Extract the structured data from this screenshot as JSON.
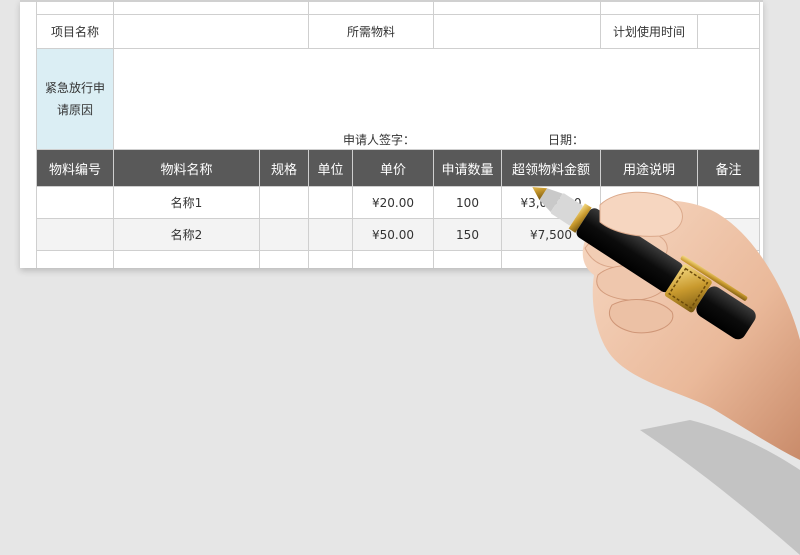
{
  "form": {
    "project_name_label": "项目名称",
    "materials_label": "所需物料",
    "planned_time_label": "计划使用时间",
    "reason_label": "紧急放行申请原因",
    "applicant_sign_label": "申请人签字：",
    "date_label": "日期："
  },
  "table": {
    "headers": [
      "物料编号",
      "物料名称",
      "规格",
      "单位",
      "单价",
      "申请数量",
      "超领物料金额",
      "用途说明",
      "备注"
    ],
    "rows": [
      {
        "code": "",
        "name": "名称1",
        "spec": "",
        "unit": "",
        "price": "¥20.00",
        "qty": "100",
        "amount": "¥3,000.00",
        "usage": "",
        "note": ""
      },
      {
        "code": "",
        "name": "名称2",
        "spec": "",
        "unit": "",
        "price": "¥50.00",
        "qty": "150",
        "amount": "¥7,500",
        "usage": "",
        "note": ""
      }
    ]
  },
  "colors": {
    "header_bg": "#595959",
    "reason_bg": "#dbeef4",
    "page_bg": "#e6e6e6"
  }
}
